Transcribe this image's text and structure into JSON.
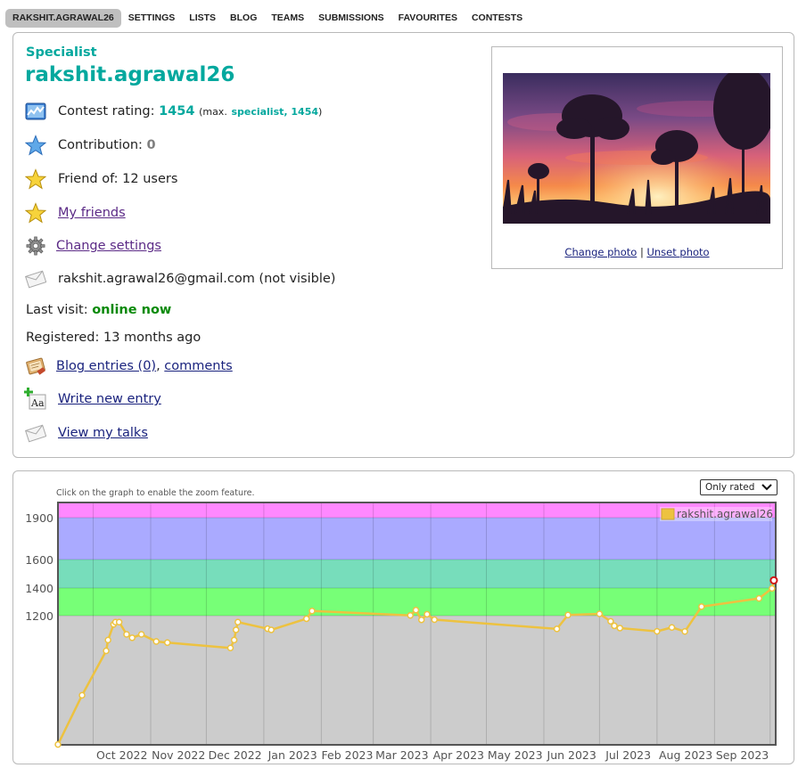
{
  "nav": {
    "items": [
      "RAKSHIT.AGRAWAL26",
      "SETTINGS",
      "LISTS",
      "BLOG",
      "TEAMS",
      "SUBMISSIONS",
      "FAVOURITES",
      "CONTESTS"
    ]
  },
  "profile": {
    "rank": "Specialist",
    "handle": "rakshit.agrawal26",
    "rating_label": "Contest rating:",
    "rating": "1454",
    "max_open": "(max.",
    "max_rank": "specialist, 1454",
    "max_close": ")",
    "contribution_label": "Contribution:",
    "contribution": "0",
    "friend_of": "Friend of: 12 users",
    "my_friends": "My friends",
    "change_settings": "Change settings",
    "email": "rakshit.agrawal26@gmail.com (not visible)",
    "last_visit_label": "Last visit:",
    "last_visit": "online now",
    "registered": "Registered: 13 months ago",
    "blog_entries": "Blog entries (0)",
    "comma": ",",
    "comments": "comments",
    "write_entry": "Write new entry",
    "view_talks": "View my talks",
    "change_photo": "Change photo",
    "separator": "|",
    "unset_photo": "Unset photo"
  },
  "rating_graph": {
    "hint": "Click on the graph to enable the zoom feature.",
    "filter": "Only rated"
  },
  "colors": {
    "accent": "#03a89e",
    "link": "#1a237e",
    "online": "#0a8a0a",
    "band_gray": "#cccccc",
    "band_green": "#77ff77",
    "band_cyan": "#77ddbb",
    "band_blue": "#aaaaff",
    "band_violet": "#ff88ff",
    "line": "#edc240"
  },
  "chart_data": {
    "type": "line",
    "legend": "rakshit.agrawal26",
    "legend_position": "top-right",
    "grid": true,
    "x_ticks": [
      "Oct 2022",
      "Nov 2022",
      "Dec 2022",
      "Jan 2023",
      "Feb 2023",
      "Mar 2023",
      "Apr 2023",
      "May 2023",
      "Jun 2023",
      "Jul 2023",
      "Aug 2023",
      "Sep 2023"
    ],
    "y_ticks": [
      1200,
      1400,
      1600,
      1900
    ],
    "xlim": [
      "2022-09-12",
      "2023-10-04"
    ],
    "ylim": [
      400,
      2000
    ],
    "bands": [
      {
        "from": 0,
        "to": 1200,
        "color": "#cccccc"
      },
      {
        "from": 1200,
        "to": 1400,
        "color": "#77ff77"
      },
      {
        "from": 1400,
        "to": 1600,
        "color": "#77ddbb"
      },
      {
        "from": 1600,
        "to": 1900,
        "color": "#aaaaff"
      },
      {
        "from": 1900,
        "to": 2100,
        "color": "#ff88ff"
      }
    ],
    "series": [
      {
        "x": [
          "2022-09-12",
          "2022-09-25",
          "2022-10-08",
          "2022-10-09",
          "2022-10-12",
          "2022-10-13",
          "2022-10-15",
          "2022-10-19",
          "2022-10-22",
          "2022-10-27",
          "2022-11-04",
          "2022-11-10",
          "2022-12-14",
          "2022-12-16",
          "2022-12-17",
          "2022-12-18",
          "2023-01-03",
          "2023-01-05",
          "2023-01-24",
          "2023-01-27",
          "2023-03-21",
          "2023-03-24",
          "2023-03-27",
          "2023-03-30",
          "2023-04-03",
          "2023-06-08",
          "2023-06-14",
          "2023-07-01",
          "2023-07-07",
          "2023-07-09",
          "2023-07-12",
          "2023-08-01",
          "2023-08-09",
          "2023-08-16",
          "2023-08-25",
          "2023-09-25",
          "2023-10-02",
          "2023-10-03"
        ],
        "y": [
          402,
          707,
          982,
          1049,
          1146,
          1160,
          1160,
          1084,
          1063,
          1084,
          1040,
          1033,
          1000,
          1049,
          1112,
          1160,
          1119,
          1112,
          1181,
          1234,
          1202,
          1240,
          1174,
          1210,
          1175,
          1118,
          1205,
          1213,
          1165,
          1137,
          1123,
          1103,
          1127,
          1102,
          1265,
          1325,
          1397,
          1454
        ]
      }
    ]
  }
}
